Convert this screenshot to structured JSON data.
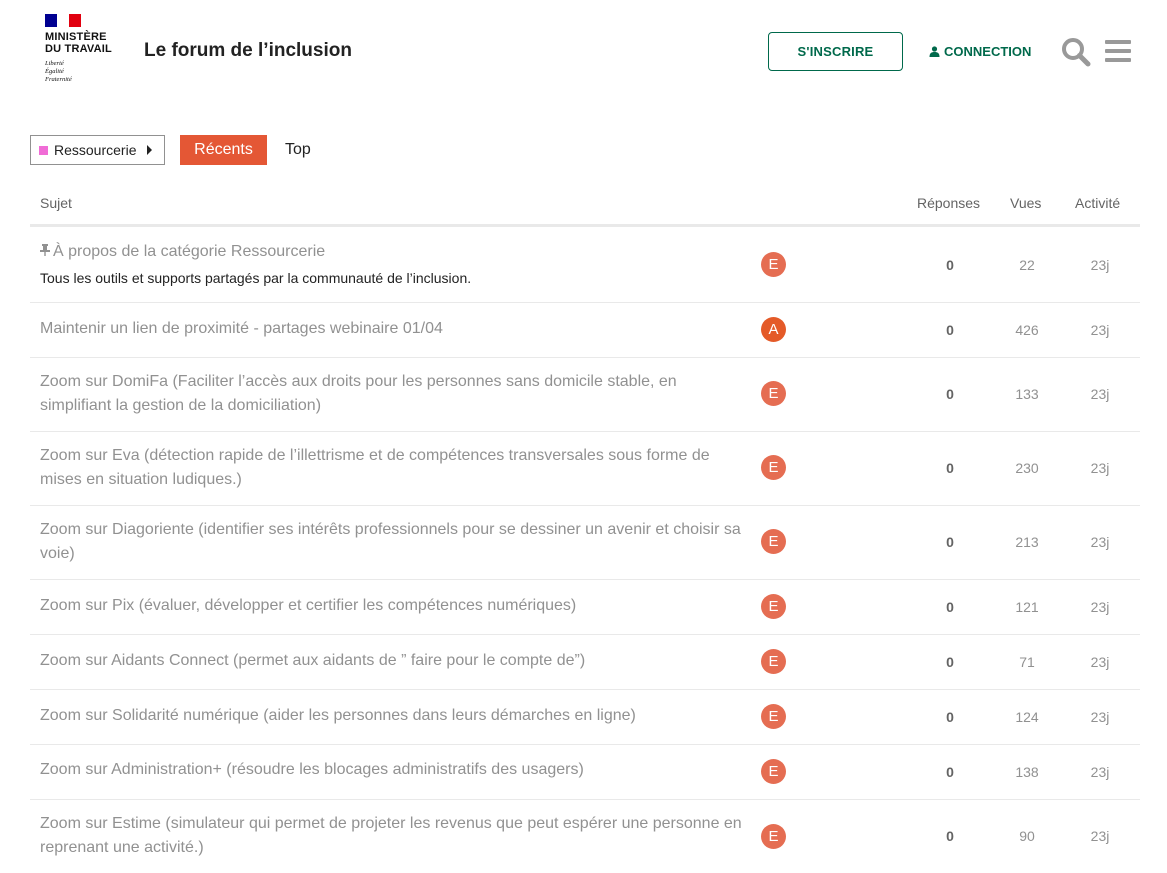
{
  "header": {
    "logo_text": [
      "MINISTÈRE",
      "DU TRAVAIL"
    ],
    "devise": [
      "Liberté",
      "Égalité",
      "Fraternité"
    ],
    "flag_colors": [
      "#000091",
      "#ffffff",
      "#e1000f"
    ],
    "site_title": "Le forum de l’inclusion",
    "signup_label": "S'INSCRIRE",
    "login_label": "CONNECTION",
    "icons": [
      "user-icon",
      "search-icon",
      "hamburger-menu-icon"
    ],
    "accent_color": "#00694b"
  },
  "nav": {
    "category": "Ressourcerie",
    "category_color": "#f06cd6",
    "tabs": [
      {
        "label": "Récents",
        "active": true
      },
      {
        "label": "Top",
        "active": false
      }
    ],
    "active_color": "#e45735"
  },
  "table": {
    "headers": {
      "subject": "Sujet",
      "replies": "Réponses",
      "views": "Vues",
      "activity": "Activité"
    },
    "rows": [
      {
        "title": "À propos de la catégorie Ressourcerie",
        "pinned": true,
        "excerpt": "Tous les outils et supports partagés par la communauté de l’inclusion.",
        "avatar_letter": "E",
        "avatar_color": "#e56d52",
        "replies": "0",
        "views": "22",
        "activity": "23j"
      },
      {
        "title": "Maintenir un lien de proximité - partages webinaire 01/04",
        "avatar_letter": "A",
        "avatar_color": "#e45a28",
        "replies": "0",
        "views": "426",
        "activity": "23j"
      },
      {
        "title": "Zoom sur DomiFa (Faciliter l’accès aux droits pour les personnes sans domicile stable, en simplifiant la gestion de la domiciliation)",
        "avatar_letter": "E",
        "avatar_color": "#e56d52",
        "replies": "0",
        "views": "133",
        "activity": "23j"
      },
      {
        "title": "Zoom sur Eva (détection rapide de l’illettrisme et de compétences transversales sous forme de mises en situation ludiques.)",
        "avatar_letter": "E",
        "avatar_color": "#e56d52",
        "replies": "0",
        "views": "230",
        "activity": "23j"
      },
      {
        "title": "Zoom sur Diagoriente (identifier ses intérêts professionnels pour se dessiner un avenir et choisir sa voie)",
        "avatar_letter": "E",
        "avatar_color": "#e56d52",
        "replies": "0",
        "views": "213",
        "activity": "23j"
      },
      {
        "title": "Zoom sur Pix (évaluer, développer et certifier les compétences numériques)",
        "avatar_letter": "E",
        "avatar_color": "#e56d52",
        "replies": "0",
        "views": "121",
        "activity": "23j"
      },
      {
        "title": "Zoom sur Aidants Connect (permet aux aidants de ” faire pour le compte de”)",
        "avatar_letter": "E",
        "avatar_color": "#e56d52",
        "replies": "0",
        "views": "71",
        "activity": "23j"
      },
      {
        "title": "Zoom sur Solidarité numérique (aider les personnes dans leurs démarches en ligne)",
        "avatar_letter": "E",
        "avatar_color": "#e56d52",
        "replies": "0",
        "views": "124",
        "activity": "23j"
      },
      {
        "title": "Zoom sur Administration+ (résoudre les blocages administratifs des usagers)",
        "avatar_letter": "E",
        "avatar_color": "#e56d52",
        "replies": "0",
        "views": "138",
        "activity": "23j"
      },
      {
        "title": "Zoom sur Estime (simulateur qui permet de projeter les revenus que peut espérer une personne en reprenant une activité.)",
        "avatar_letter": "E",
        "avatar_color": "#e56d52",
        "replies": "0",
        "views": "90",
        "activity": "23j"
      }
    ]
  }
}
